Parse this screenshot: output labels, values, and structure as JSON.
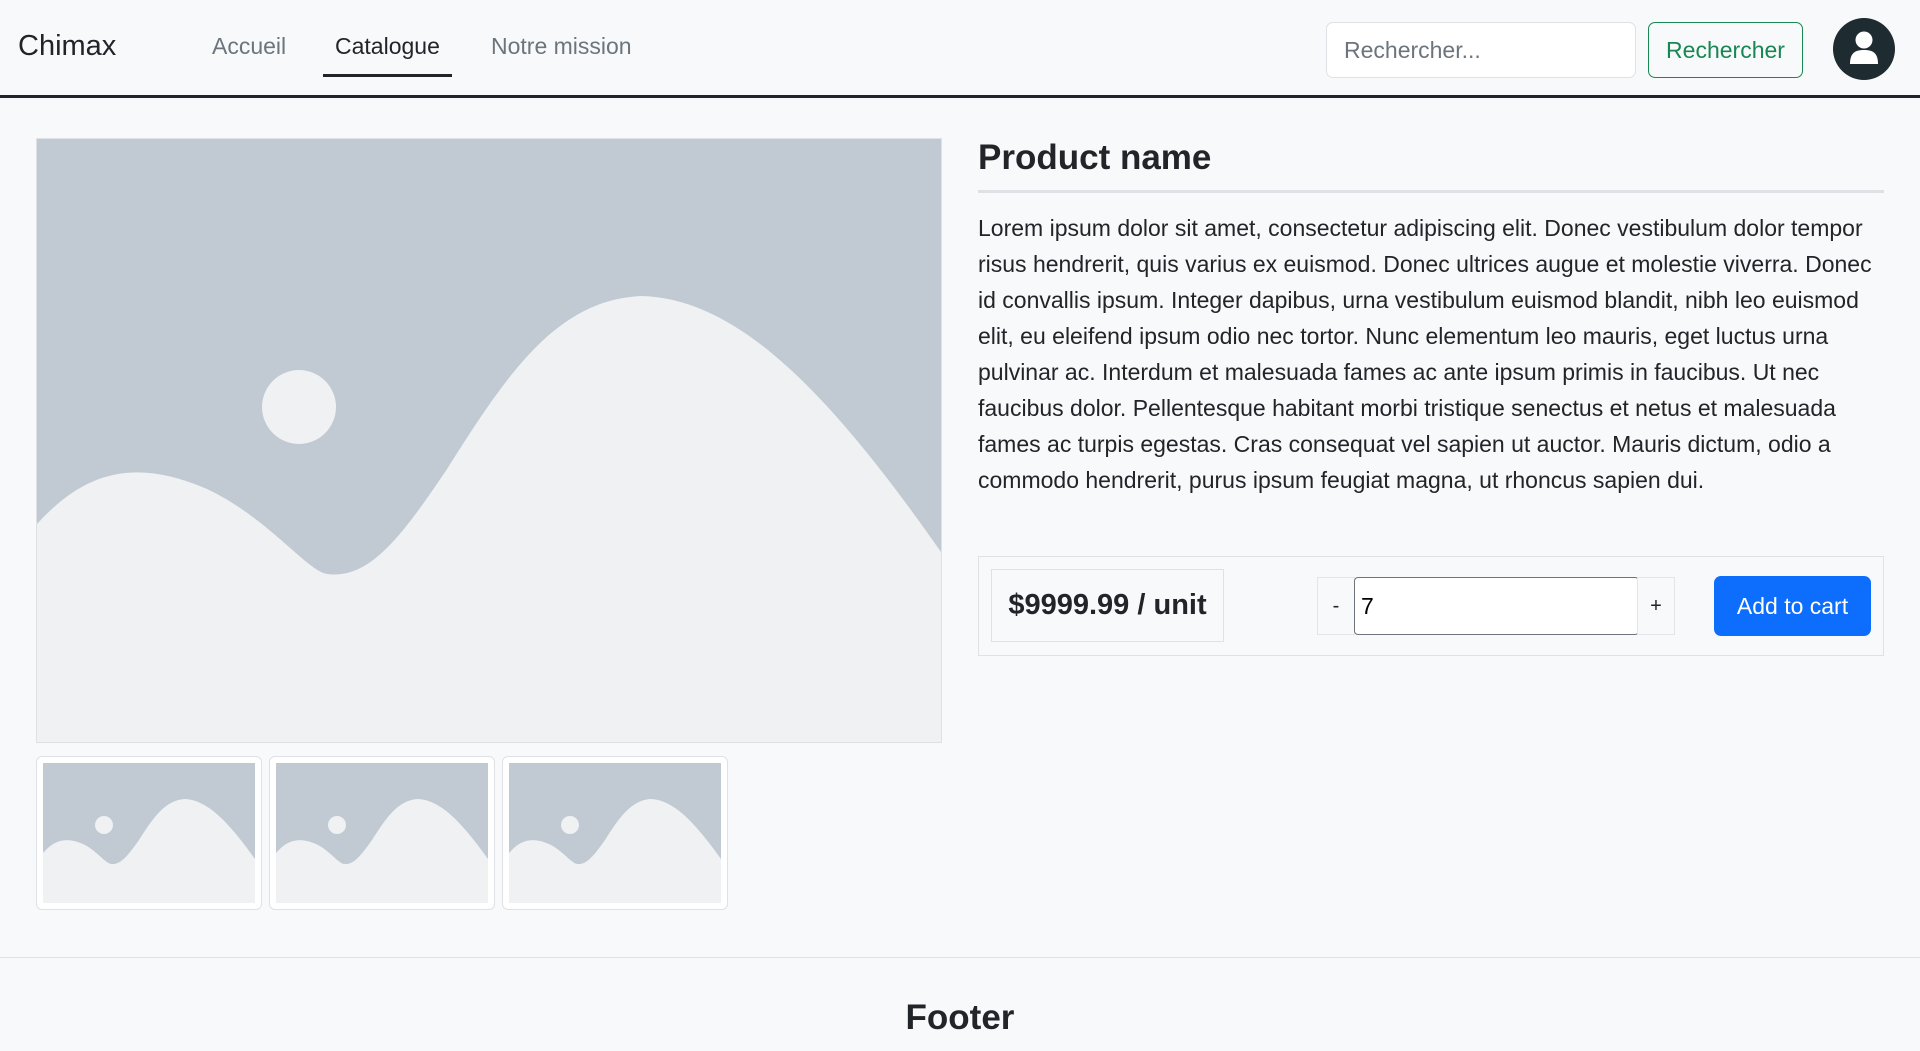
{
  "navbar": {
    "brand": "Chimax",
    "links": [
      {
        "label": "Accueil",
        "active": false
      },
      {
        "label": "Catalogue",
        "active": true
      },
      {
        "label": "Notre mission",
        "active": false
      }
    ],
    "search": {
      "placeholder": "Rechercher...",
      "value": "",
      "button_label": "Rechercher"
    },
    "avatar_icon": "user-icon"
  },
  "gallery": {
    "main_image_icon": "image-placeholder-icon",
    "thumbnails": [
      {
        "icon": "image-placeholder-icon"
      },
      {
        "icon": "image-placeholder-icon"
      },
      {
        "icon": "image-placeholder-icon"
      }
    ]
  },
  "product": {
    "name": "Product name",
    "description": "Lorem ipsum dolor sit amet, consectetur adipiscing elit. Donec vestibulum dolor tempor risus hendrerit, quis varius ex euismod. Donec ultrices augue et molestie viverra. Donec id convallis ipsum. Integer dapibus, urna vestibulum euismod blandit, nibh leo euismod elit, eu eleifend ipsum odio nec tortor. Nunc elementum leo mauris, eget luctus urna pulvinar ac. Interdum et malesuada fames ac ante ipsum primis in faucibus. Ut nec faucibus dolor. Pellentesque habitant morbi tristique senectus et netus et malesuada fames ac turpis egestas. Cras consequat vel sapien ut auctor. Mauris dictum, odio a commodo hendrerit, purus ipsum feugiat magna, ut rhoncus sapien dui.",
    "price": "$9999.99 / unit",
    "quantity": {
      "minus_label": "-",
      "plus_label": "+",
      "value": "7"
    },
    "add_to_cart_label": "Add to cart"
  },
  "footer": {
    "title": "Footer"
  },
  "colors": {
    "primary": "#0d6efd",
    "success": "#198754",
    "placeholder_dark": "#c1c9d2",
    "placeholder_light": "#eff1f3",
    "avatar_bg": "#1e2b30"
  }
}
